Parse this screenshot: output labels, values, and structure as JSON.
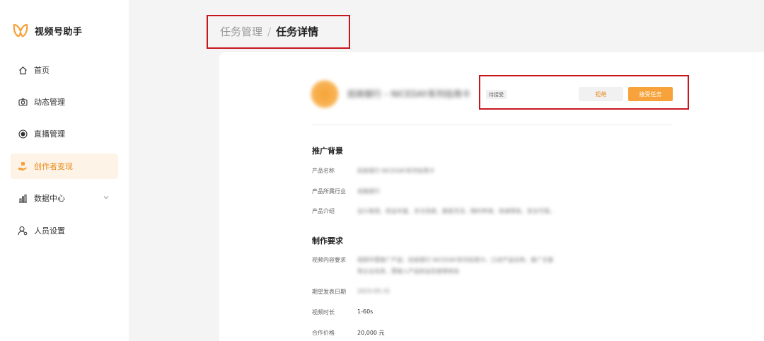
{
  "app": {
    "name": "视频号助手",
    "brand_color": "#f7a23a"
  },
  "sidebar": {
    "items": [
      {
        "label": "首页",
        "icon": "home-icon"
      },
      {
        "label": "动态管理",
        "icon": "camera-icon"
      },
      {
        "label": "直播管理",
        "icon": "live-record-icon"
      },
      {
        "label": "创作者变现",
        "icon": "creator-hand-icon",
        "active": true
      },
      {
        "label": "数据中心",
        "icon": "bar-chart-icon",
        "has_submenu": true
      },
      {
        "label": "人员设置",
        "icon": "user-settings-icon"
      }
    ]
  },
  "breadcrumb": {
    "parent": "任务管理",
    "separator": "/",
    "current": "任务详情"
  },
  "task": {
    "title": "招商银行 – NICEDAY系列信用卡",
    "status": "待接受",
    "reject_label": "拒绝",
    "accept_label": "接受任务"
  },
  "background_section": {
    "title": "推广背景",
    "fields": [
      {
        "label": "产品名称",
        "value": "招商银行 NICEDAY系列信用卡"
      },
      {
        "label": "产品所属行业",
        "value": "金融银行"
      },
      {
        "label": "产品介绍",
        "value": "设计美观、权益丰富、多元场景、额度灵活、随时申请、快速审批、安全可靠。"
      }
    ]
  },
  "requirements_section": {
    "title": "制作要求",
    "fields": [
      {
        "label": "视频内容要求",
        "value_line1": "视频中需推广产品：招商银行 NICEDAY系列信用卡，口述产品名称、推广文案",
        "value_line2": "等企业信息，需植入产品权益及使用体验"
      },
      {
        "label": "期望发表日期",
        "value": "2023-05-31"
      },
      {
        "label": "视频时长",
        "value": "1-60s"
      },
      {
        "label": "合作价格",
        "value": "20,000 元"
      }
    ]
  }
}
